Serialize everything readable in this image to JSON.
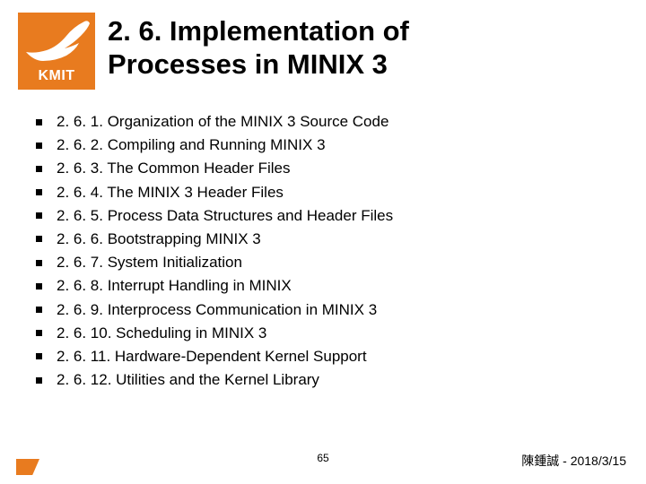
{
  "logo": {
    "text": "KMIT"
  },
  "title_line1": "2. 6. Implementation of",
  "title_line2": "Processes in MINIX 3",
  "items": [
    "2. 6. 1. Organization of the MINIX 3 Source Code",
    "2. 6. 2. Compiling and Running MINIX 3",
    "2. 6. 3. The Common Header Files",
    "2. 6. 4. The MINIX 3 Header Files",
    "2. 6. 5. Process Data Structures and Header Files",
    "2. 6. 6. Bootstrapping MINIX 3",
    "2. 6. 7. System Initialization",
    "2. 6. 8. Interrupt Handling in MINIX",
    "2. 6. 9. Interprocess Communication in MINIX 3",
    "2. 6. 10. Scheduling in MINIX 3",
    "2. 6. 11. Hardware-Dependent Kernel Support",
    "2. 6. 12. Utilities and the Kernel Library"
  ],
  "footer": {
    "page": "65",
    "author": "陳鍾誠",
    "sep": " - ",
    "date": "2018/3/15"
  }
}
